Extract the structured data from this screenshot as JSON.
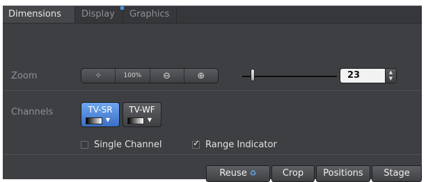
{
  "tabs": [
    {
      "label": "Dimensions",
      "active": true
    },
    {
      "label": "Display",
      "active": false
    },
    {
      "label": "Graphics",
      "active": false
    }
  ],
  "zoom": {
    "label": "Zoom",
    "buttons": [
      {
        "name": "fit-icon",
        "glyph": "⊹"
      },
      {
        "name": "zoom-100-button",
        "glyph": "100%"
      },
      {
        "name": "zoom-out-icon",
        "glyph": "⊖"
      },
      {
        "name": "zoom-in-icon",
        "glyph": "⊕"
      }
    ],
    "slider_fraction": 0.1,
    "value": "23"
  },
  "channels": {
    "label": "Channels",
    "items": [
      {
        "label": "TV-SR",
        "active": true
      },
      {
        "label": "TV-WF",
        "active": false
      }
    ],
    "single_channel_label": "Single Channel",
    "single_channel_checked": false,
    "range_indicator_label": "Range Indicator",
    "range_indicator_checked": true
  },
  "bottom_buttons": {
    "reuse": "Reuse",
    "crop": "Crop",
    "positions": "Positions",
    "stage": "Stage"
  },
  "colors": {
    "panel_bg": "#3e3f42",
    "accent": "#4a8de0",
    "active_channel": "#5a93e0"
  }
}
